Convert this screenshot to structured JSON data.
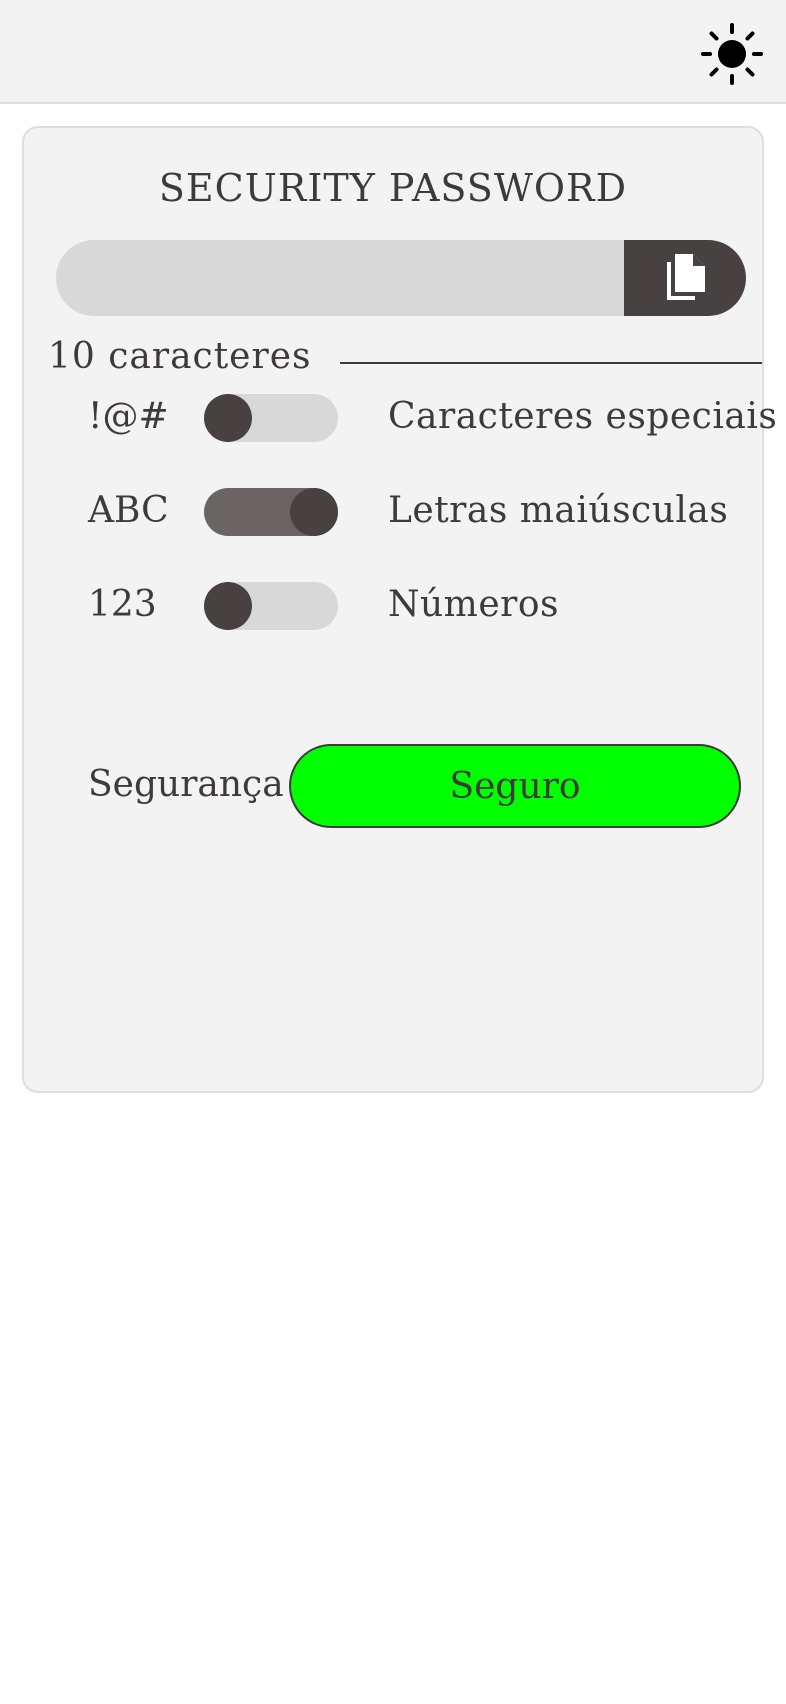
{
  "header": {
    "theme_toggle_icon": "sun-icon"
  },
  "card": {
    "title": "SECURITY PASSWORD",
    "password": {
      "value": "",
      "copy_icon": "copy-icon"
    },
    "length": {
      "label": "10 caracteres",
      "value": 10
    },
    "options": [
      {
        "symbol": "!@#",
        "label": "Caracteres especiais",
        "enabled": false
      },
      {
        "symbol": "ABC",
        "label": "Letras maiúsculas",
        "enabled": true
      },
      {
        "symbol": "123",
        "label": "Números",
        "enabled": false
      }
    ],
    "security": {
      "label": "Segurança",
      "status": "Seguro",
      "status_color": "#00ff00"
    }
  },
  "colors": {
    "dark": "#474141",
    "text": "#3f3a3a",
    "panel": "#f3f3f3",
    "field": "#d8d8d8"
  }
}
